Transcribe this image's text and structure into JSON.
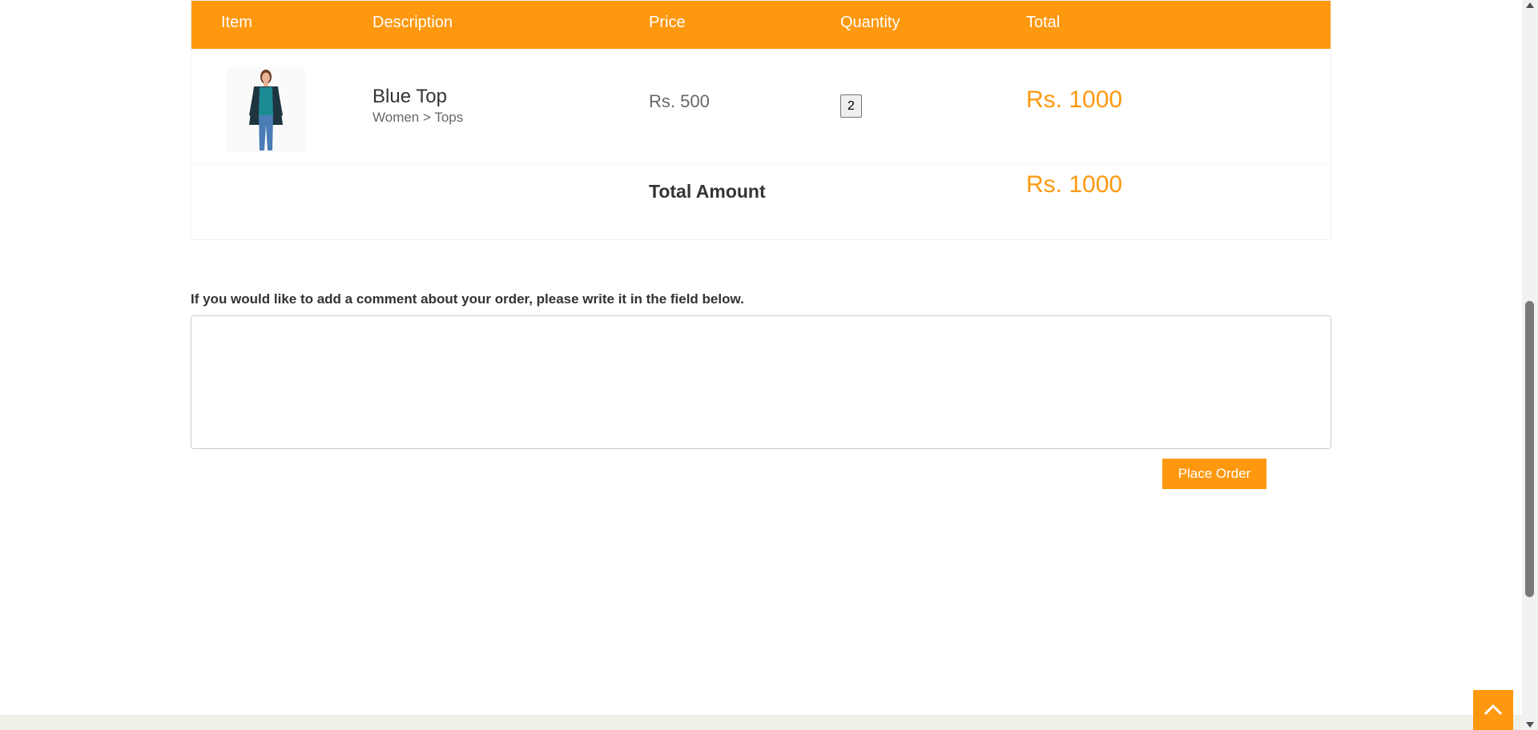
{
  "cart": {
    "headers": {
      "item": "Item",
      "description": "Description",
      "price": "Price",
      "quantity": "Quantity",
      "total": "Total"
    },
    "items": [
      {
        "name": "Blue Top",
        "category": "Women > Tops",
        "price": "Rs. 500",
        "quantity": "2",
        "total": "Rs. 1000"
      }
    ],
    "total_label": "Total Amount",
    "total_value": "Rs. 1000"
  },
  "comment": {
    "label": "If you would like to add a comment about your order, please write it in the field below.",
    "value": ""
  },
  "actions": {
    "place_order": "Place Order"
  },
  "colors": {
    "accent": "#fe980f",
    "footer": "#f0f0e9"
  },
  "icons": {
    "scroll_up": "chevron-up-icon"
  }
}
